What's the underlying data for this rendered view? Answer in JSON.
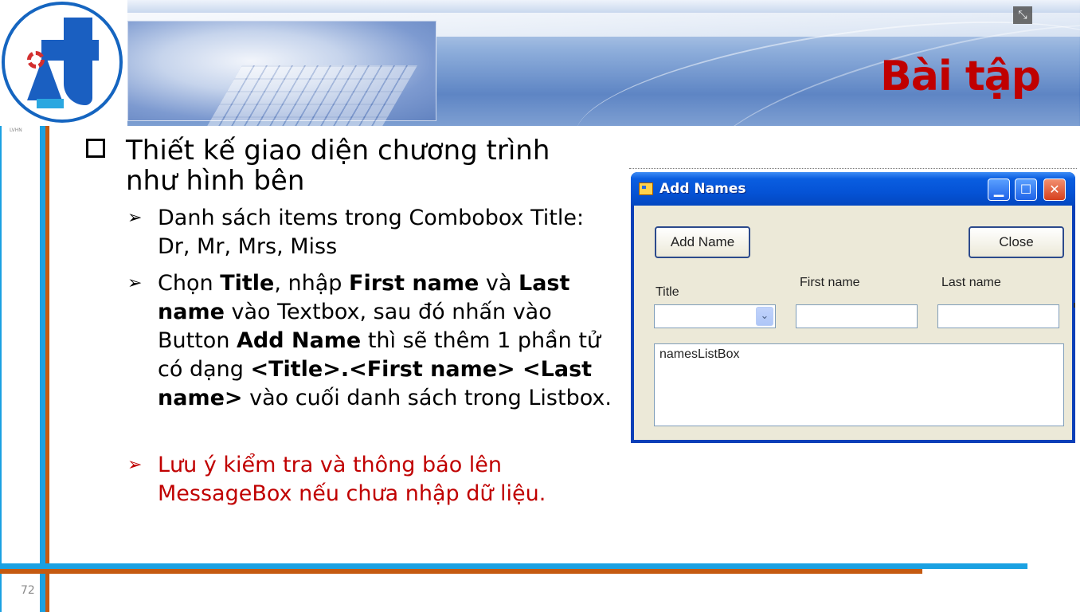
{
  "slide": {
    "title": "Bài tập",
    "page_number": "72",
    "logo_caption": "LVHN"
  },
  "content": {
    "main_bullet": "Thiết kế giao diện chương trình như hình bên",
    "sub_bullets": [
      {
        "parts": [
          {
            "text": "Danh sách items trong Combobox Title: Dr, Mr, Mrs, Miss",
            "bold": false
          }
        ]
      },
      {
        "parts": [
          {
            "text": "Chọn ",
            "bold": false
          },
          {
            "text": "Title",
            "bold": true
          },
          {
            "text": ", nhập ",
            "bold": false
          },
          {
            "text": "First name",
            "bold": true
          },
          {
            "text": " và ",
            "bold": false
          },
          {
            "text": "Last name",
            "bold": true
          },
          {
            "text": " vào Textbox, sau đó nhấn vào Button ",
            "bold": false
          },
          {
            "text": "Add Name",
            "bold": true
          },
          {
            "text": " thì sẽ thêm 1 phần tử có dạng ",
            "bold": false
          },
          {
            "text": "<Title>.<First name> <Last name>",
            "bold": true
          },
          {
            "text": " vào cuối danh sách trong Listbox.",
            "bold": false
          }
        ]
      },
      {
        "parts": [
          {
            "text": "Lưu ý kiểm tra và thông báo lên MessageBox nếu chưa nhập dữ liệu.",
            "bold": false
          }
        ],
        "color": "#c00000"
      }
    ]
  },
  "form": {
    "window_title": "Add Names",
    "add_button": "Add Name",
    "close_button": "Close",
    "title_label": "Title",
    "first_name_label": "First name",
    "last_name_label": "Last name",
    "listbox_text": "namesListBox",
    "title_combo_value": "",
    "first_name_value": "",
    "last_name_value": ""
  },
  "colors": {
    "title_red": "#c00000",
    "accent_blue": "#1ba1e2",
    "accent_orange": "#c55a11"
  }
}
